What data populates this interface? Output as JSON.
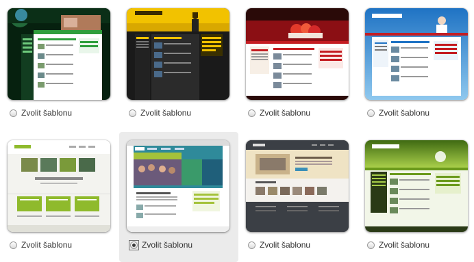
{
  "templates": [
    {
      "name": "template-1",
      "option_label": "Zvolit šablonu",
      "selected": false,
      "header_title": "LaMeta"
    },
    {
      "name": "template-2",
      "option_label": "Zvolit šablonu",
      "selected": false,
      "header_title": "LaMeta Travel"
    },
    {
      "name": "template-3",
      "option_label": "Zvolit šablonu",
      "selected": false,
      "header_title": "LaMeta"
    },
    {
      "name": "template-4",
      "option_label": "Zvolit šablonu",
      "selected": false,
      "header_title": "LaMeta Travel"
    },
    {
      "name": "template-5",
      "option_label": "Zvolit šablonu",
      "selected": false,
      "header_title": "Portfolio"
    },
    {
      "name": "template-6",
      "option_label": "Zvolit šablonu",
      "selected": true,
      "header_title": "LaMeta"
    },
    {
      "name": "template-7",
      "option_label": "Zvolit šablonu",
      "selected": false,
      "header_title": "Blue"
    },
    {
      "name": "template-8",
      "option_label": "Zvolit šablonu",
      "selected": false,
      "header_title": "LaMeta Travel"
    }
  ],
  "colors": {
    "selected_bg": "#ebebeb",
    "label": "#333333",
    "t1": "#0d3b1c",
    "t2": "#f2c200",
    "t3": "#8b0f14",
    "t4": "#1f73c4",
    "t5": "#8fba2c",
    "t6": "#2f8a9a",
    "t7": "#3b3f45",
    "t8": "#6b9a1c"
  }
}
